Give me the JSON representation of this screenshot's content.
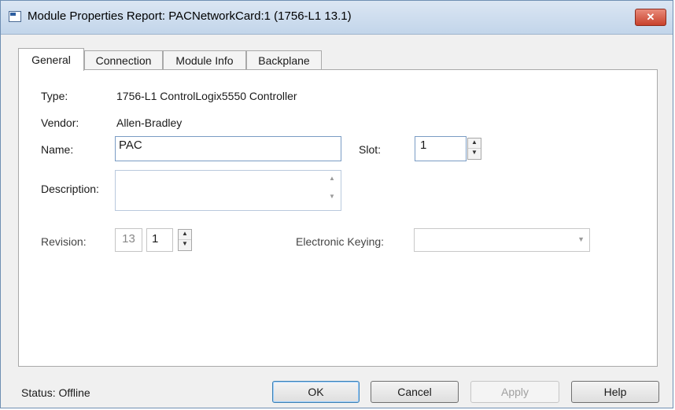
{
  "window": {
    "title": "Module Properties Report: PACNetworkCard:1 (1756-L1 13.1)",
    "close_glyph": "✕"
  },
  "tabs": [
    {
      "label": "General",
      "active": true
    },
    {
      "label": "Connection",
      "active": false
    },
    {
      "label": "Module Info",
      "active": false
    },
    {
      "label": "Backplane",
      "active": false
    }
  ],
  "general": {
    "type_label": "Type:",
    "type_value": "1756-L1 ControlLogix5550 Controller",
    "vendor_label": "Vendor:",
    "vendor_value": "Allen-Bradley",
    "name_label": "Name:",
    "name_value": "PAC",
    "slot_label": "Slot:",
    "slot_value": "1",
    "description_label": "Description:",
    "description_value": "",
    "revision_label": "Revision:",
    "revision_major": "13",
    "revision_minor": "1",
    "keying_label": "Electronic Keying:",
    "keying_value": ""
  },
  "footer": {
    "status_label": "Status:",
    "status_value": "Offline",
    "ok": "OK",
    "cancel": "Cancel",
    "apply": "Apply",
    "help": "Help"
  },
  "glyphs": {
    "up": "▲",
    "down": "▼",
    "scroll_up": "▲",
    "scroll_down": "▼",
    "dropdown": "▼"
  }
}
